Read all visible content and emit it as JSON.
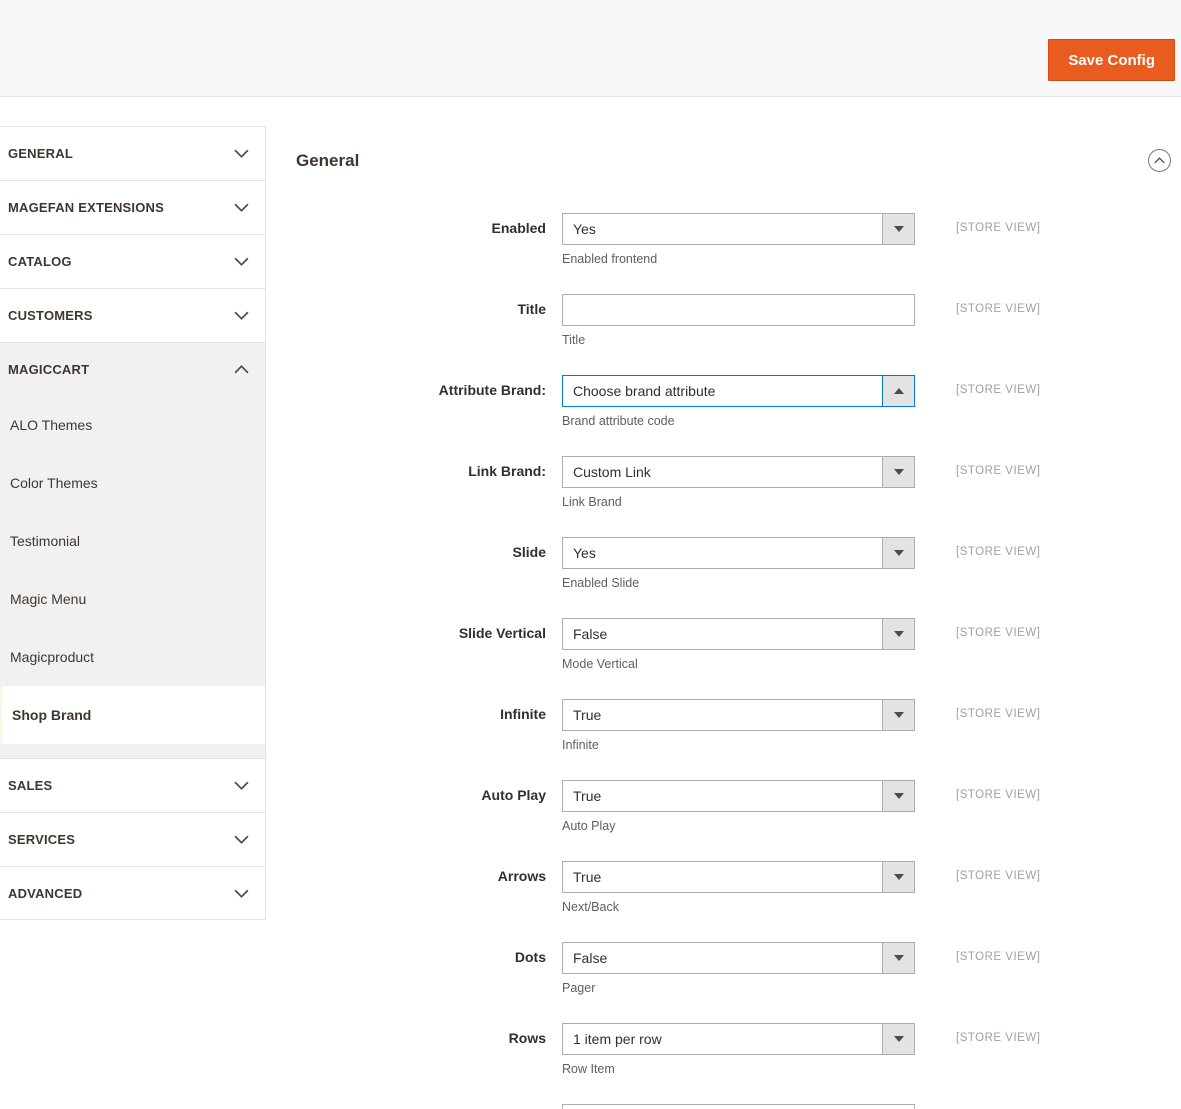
{
  "header": {
    "save_button": "Save Config"
  },
  "section": {
    "title": "General"
  },
  "sidebar": {
    "sections": [
      {
        "label": "GENERAL",
        "state": "collapsed"
      },
      {
        "label": "MAGEFAN EXTENSIONS",
        "state": "collapsed"
      },
      {
        "label": "CATALOG",
        "state": "collapsed"
      },
      {
        "label": "CUSTOMERS",
        "state": "collapsed"
      },
      {
        "label": "MAGICCART",
        "state": "expanded",
        "items": [
          {
            "label": "ALO Themes",
            "active": false
          },
          {
            "label": "Color Themes",
            "active": false
          },
          {
            "label": "Testimonial",
            "active": false
          },
          {
            "label": "Magic Menu",
            "active": false
          },
          {
            "label": "Magicproduct",
            "active": false
          },
          {
            "label": "Shop Brand",
            "active": true
          }
        ]
      },
      {
        "label": "SALES",
        "state": "collapsed"
      },
      {
        "label": "SERVICES",
        "state": "collapsed"
      },
      {
        "label": "ADVANCED",
        "state": "collapsed"
      }
    ]
  },
  "form": {
    "fields": [
      {
        "label": "Enabled",
        "type": "select",
        "value": "Yes",
        "note": "Enabled frontend",
        "scope": "[STORE VIEW]",
        "focused": false
      },
      {
        "label": "Title",
        "type": "text",
        "value": "",
        "note": "Title",
        "scope": "[STORE VIEW]",
        "focused": false
      },
      {
        "label": "Attribute Brand:",
        "type": "select",
        "value": "Choose brand attribute",
        "note": "Brand attribute code",
        "scope": "[STORE VIEW]",
        "focused": true
      },
      {
        "label": "Link Brand:",
        "type": "select",
        "value": "Custom Link",
        "note": "Link Brand",
        "scope": "[STORE VIEW]",
        "focused": false
      },
      {
        "label": "Slide",
        "type": "select",
        "value": "Yes",
        "note": "Enabled Slide",
        "scope": "[STORE VIEW]",
        "focused": false
      },
      {
        "label": "Slide Vertical",
        "type": "select",
        "value": "False",
        "note": "Mode Vertical",
        "scope": "[STORE VIEW]",
        "focused": false
      },
      {
        "label": "Infinite",
        "type": "select",
        "value": "True",
        "note": "Infinite",
        "scope": "[STORE VIEW]",
        "focused": false
      },
      {
        "label": "Auto Play",
        "type": "select",
        "value": "True",
        "note": "Auto Play",
        "scope": "[STORE VIEW]",
        "focused": false
      },
      {
        "label": "Arrows",
        "type": "select",
        "value": "True",
        "note": "Next/Back",
        "scope": "[STORE VIEW]",
        "focused": false
      },
      {
        "label": "Dots",
        "type": "select",
        "value": "False",
        "note": "Pager",
        "scope": "[STORE VIEW]",
        "focused": false
      },
      {
        "label": "Rows",
        "type": "select",
        "value": "1 item per row",
        "note": "Row Item",
        "scope": "[STORE VIEW]",
        "focused": false
      }
    ]
  },
  "colors": {
    "accent_orange": "#e95b1e",
    "focus_blue": "#007bdb",
    "border_gray": "#e3e3e3",
    "input_border": "#adadad",
    "header_bg": "#f8f8f8",
    "submenu_bg": "#f1f1f1",
    "text_dark": "#303030",
    "scope_gray": "#a5a09b"
  }
}
